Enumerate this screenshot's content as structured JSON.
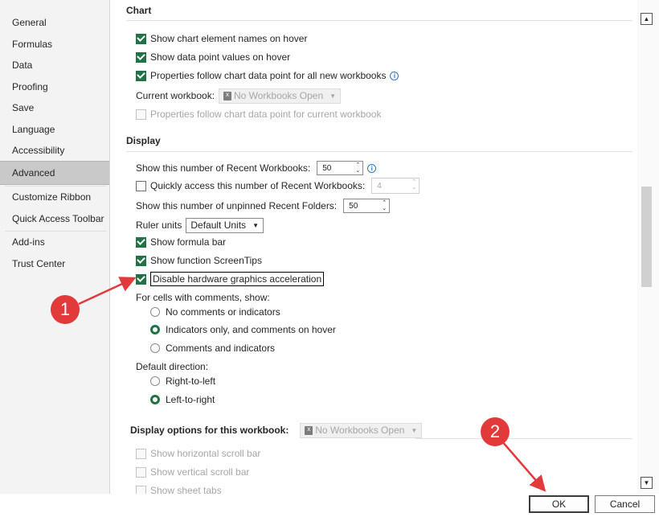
{
  "sidebar": {
    "items": [
      {
        "label": "General"
      },
      {
        "label": "Formulas"
      },
      {
        "label": "Data"
      },
      {
        "label": "Proofing"
      },
      {
        "label": "Save"
      },
      {
        "label": "Language"
      },
      {
        "label": "Accessibility"
      },
      {
        "label": "Advanced"
      },
      {
        "label": "Customize Ribbon"
      },
      {
        "label": "Quick Access Toolbar"
      },
      {
        "label": "Add-ins"
      },
      {
        "label": "Trust Center"
      }
    ],
    "active": "Advanced"
  },
  "chart_section": {
    "title": "Chart",
    "show_element_names": "Show chart element names on hover",
    "show_data_values": "Show data point values on hover",
    "properties_follow_all": "Properties follow chart data point for all new workbooks",
    "current_workbook_label": "Current workbook:",
    "current_workbook_value": "No Workbooks Open",
    "properties_follow_current": "Properties follow chart data point for current workbook"
  },
  "display_section": {
    "title": "Display",
    "recent_workbooks_label": "Show this number of Recent Workbooks:",
    "recent_workbooks_value": "50",
    "quick_access_label": "Quickly access this number of Recent Workbooks:",
    "quick_access_value": "4",
    "unpinned_folders_label": "Show this number of unpinned Recent Folders:",
    "unpinned_folders_value": "50",
    "ruler_units_label": "Ruler units",
    "ruler_units_value": "Default Units",
    "show_formula_bar": "Show formula bar",
    "show_screentips": "Show function ScreenTips",
    "disable_hw_accel": "Disable hardware graphics acceleration",
    "comments_label": "For cells with comments, show:",
    "comments_options": [
      "No comments or indicators",
      "Indicators only, and comments on hover",
      "Comments and indicators"
    ],
    "comments_selected": 1,
    "direction_label": "Default direction:",
    "direction_options": [
      "Right-to-left",
      "Left-to-right"
    ],
    "direction_selected": 1
  },
  "workbook_display_section": {
    "title": "Display options for this workbook:",
    "workbook_value": "No Workbooks Open",
    "show_horizontal_scroll": "Show horizontal scroll bar",
    "show_vertical_scroll": "Show vertical scroll bar",
    "show_sheet_tabs": "Show sheet tabs"
  },
  "buttons": {
    "ok": "OK",
    "cancel": "Cancel"
  },
  "annotations": {
    "badge_1": "1",
    "badge_2": "2",
    "color": "#e23a3a"
  },
  "colors": {
    "accent": "#217346",
    "sidebar_bg": "#f3f3f3",
    "active_bg": "#c9c9c9"
  }
}
